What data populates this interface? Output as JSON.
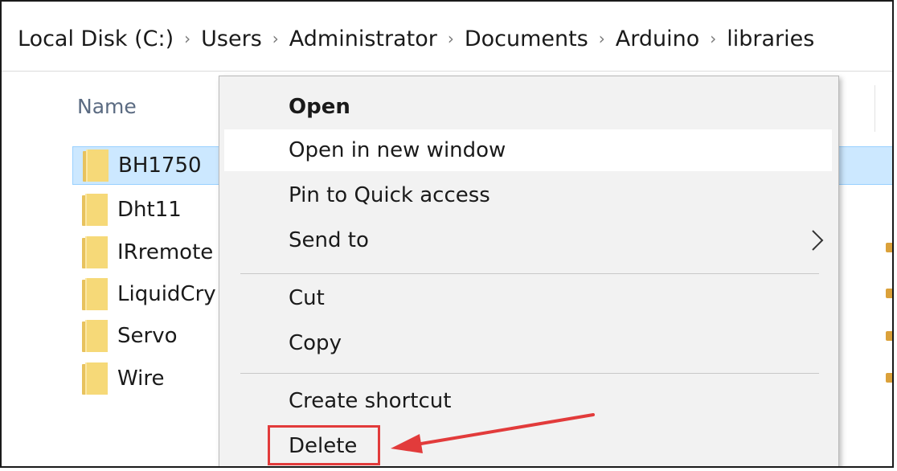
{
  "breadcrumb": [
    "Local Disk (C:)",
    "Users",
    "Administrator",
    "Documents",
    "Arduino",
    "libraries"
  ],
  "breadcrumb_separator": "›",
  "columns": {
    "name": "Name"
  },
  "files": [
    {
      "name": "BH1750",
      "selected": true
    },
    {
      "name": "Dht11"
    },
    {
      "name": "IRremote"
    },
    {
      "name": "LiquidCry"
    },
    {
      "name": "Servo"
    },
    {
      "name": "Wire"
    }
  ],
  "context_menu": {
    "items": [
      {
        "label": "Open",
        "bold": true
      },
      {
        "label": "Open in new window",
        "hover": true
      },
      {
        "label": "Pin to Quick access"
      },
      {
        "label": "Send to",
        "submenu": true
      },
      {
        "label": "Cut"
      },
      {
        "label": "Copy"
      },
      {
        "label": "Create shortcut"
      },
      {
        "label": "Delete",
        "highlighted": true
      }
    ]
  },
  "annotation": {
    "color": "#e23b3b",
    "target": "Delete"
  },
  "colors": {
    "selection": "#cce8ff",
    "folder": "#f6d978",
    "menu_bg": "#f2f2f2"
  }
}
